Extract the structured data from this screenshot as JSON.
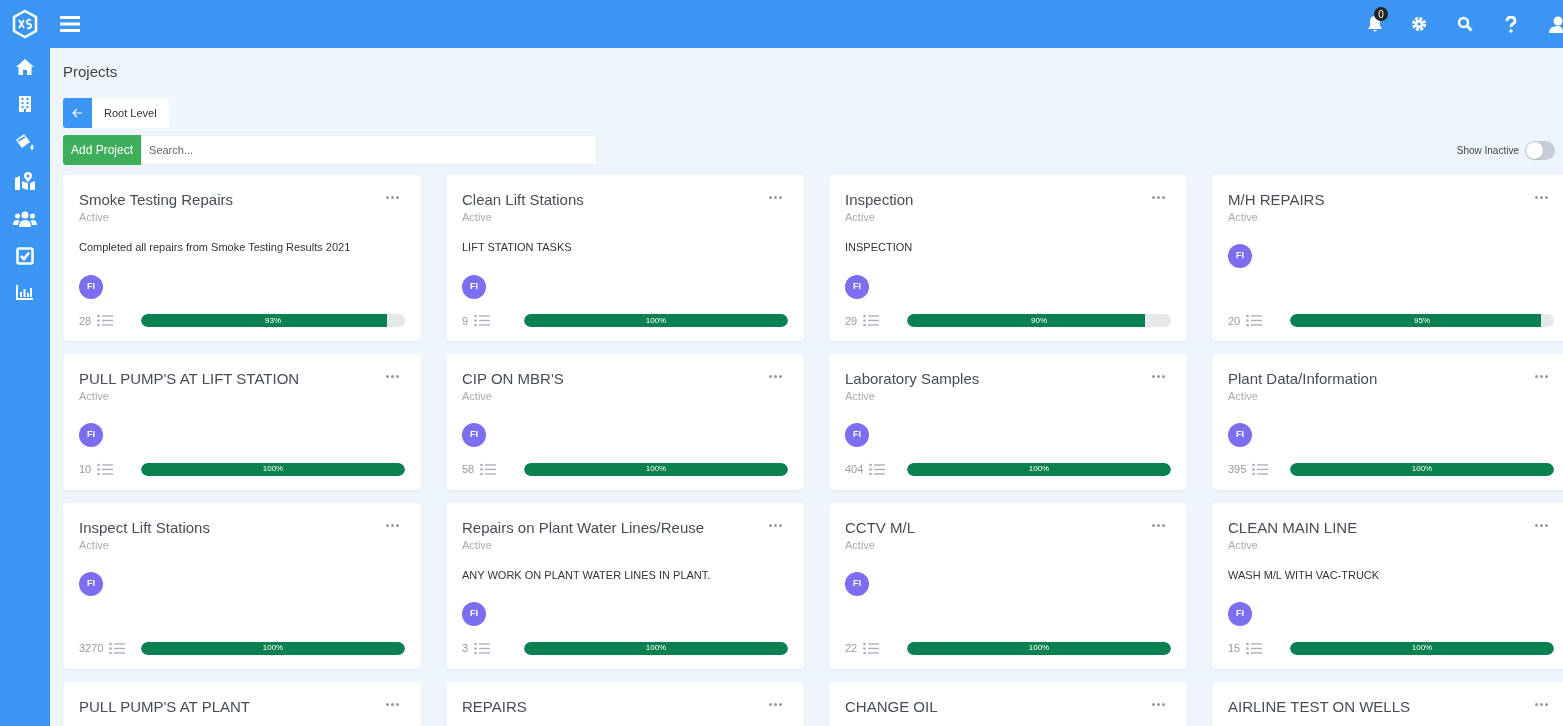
{
  "header": {
    "notification_count": "0"
  },
  "page": {
    "title": "Projects",
    "breadcrumb": "Root Level",
    "add_button": "Add Project",
    "search": {
      "placeholder": "Search..."
    },
    "show_inactive": {
      "label": "Show Inactive",
      "on": false
    }
  },
  "projects": [
    {
      "title": "Smoke Testing Repairs",
      "status": "Active",
      "description": "Completed all repairs from Smoke Testing Results 2021",
      "avatar": "FI",
      "count": "28",
      "level": 0.93,
      "percent": "93%"
    },
    {
      "title": "Clean Lift Stations",
      "status": "Active",
      "description": "LIFT STATION TASKS",
      "avatar": "FI",
      "count": "9",
      "level": 1,
      "percent": "100%"
    },
    {
      "title": "Inspection",
      "status": "Active",
      "description": "INSPECTION",
      "avatar": "FI",
      "count": "29",
      "level": 0.9,
      "percent": "90%"
    },
    {
      "title": "M/H REPAIRS",
      "status": "Active",
      "avatar": "FI",
      "count": "20",
      "level": 0.95,
      "percent": "95%"
    },
    {
      "title": "PULL PUMP'S AT LIFT STATION",
      "status": "Active",
      "avatar": "FI",
      "count": "10",
      "level": 1,
      "percent": "100%"
    },
    {
      "title": "CIP ON MBR'S",
      "status": "Active",
      "avatar": "FI",
      "count": "58",
      "level": 1,
      "percent": "100%"
    },
    {
      "title": "Laboratory Samples",
      "status": "Active",
      "avatar": "FI",
      "count": "404",
      "level": 1,
      "percent": "100%"
    },
    {
      "title": "Plant Data/Information",
      "status": "Active",
      "avatar": "FI",
      "count": "395",
      "level": 1,
      "percent": "100%"
    },
    {
      "title": "Inspect Lift Stations",
      "status": "Active",
      "avatar": "FI",
      "count": "3270",
      "level": 1,
      "percent": "100%"
    },
    {
      "title": "Repairs on Plant Water Lines/Reuse",
      "status": "Active",
      "description": "ANY WORK ON PLANT WATER LINES IN PLANT.",
      "avatar": "FI",
      "count": "3",
      "level": 1,
      "percent": "100%"
    },
    {
      "title": "CCTV M/L",
      "status": "Active",
      "avatar": "FI",
      "count": "22",
      "level": 1,
      "percent": "100%"
    },
    {
      "title": "CLEAN MAIN LINE",
      "status": "Active",
      "description": "WASH M/L WITH VAC-TRUCK",
      "avatar": "FI",
      "count": "15",
      "level": 1,
      "percent": "100%"
    },
    {
      "title": "PULL PUMP'S AT PLANT"
    },
    {
      "title": "REPAIRS"
    },
    {
      "title": "CHANGE OIL"
    },
    {
      "title": "AIRLINE TEST ON WELLS"
    }
  ]
}
